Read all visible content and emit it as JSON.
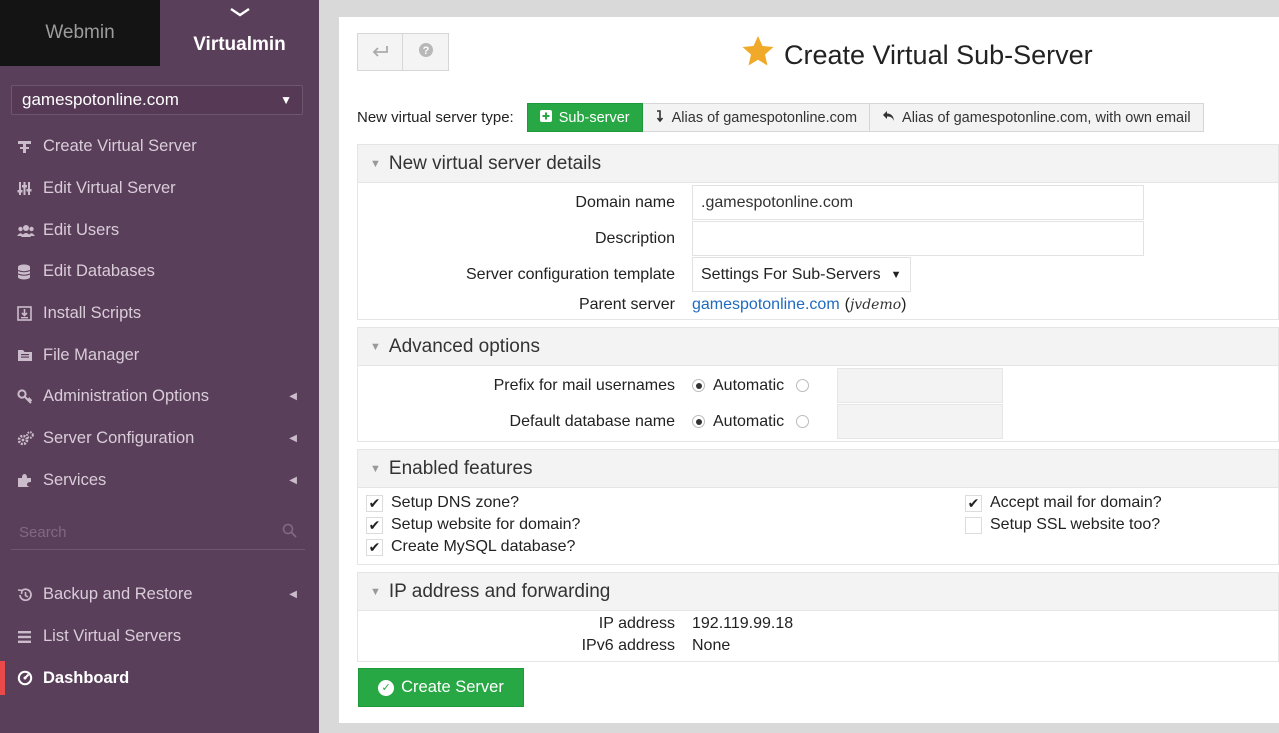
{
  "sidebar": {
    "tabs": {
      "webmin": "Webmin",
      "virtualmin": "Virtualmin"
    },
    "domain_selected": "gamespotonline.com",
    "menu": [
      {
        "label": "Create Virtual Server",
        "icon": "plus-icon"
      },
      {
        "label": "Edit Virtual Server",
        "icon": "sliders-icon"
      },
      {
        "label": "Edit Users",
        "icon": "users-icon"
      },
      {
        "label": "Edit Databases",
        "icon": "database-icon"
      },
      {
        "label": "Install Scripts",
        "icon": "download-icon"
      },
      {
        "label": "File Manager",
        "icon": "folder-icon"
      },
      {
        "label": "Administration Options",
        "icon": "key-icon"
      },
      {
        "label": "Server Configuration",
        "icon": "cogs-icon"
      },
      {
        "label": "Services",
        "icon": "puzzle-icon"
      }
    ],
    "search_placeholder": "Search",
    "menu_bottom": [
      {
        "label": "Backup and Restore",
        "icon": "history-icon"
      },
      {
        "label": "List Virtual Servers",
        "icon": "list-icon"
      },
      {
        "label": "Dashboard",
        "icon": "dashboard-icon"
      }
    ]
  },
  "main": {
    "title": "Create Virtual Sub-Server",
    "type_label": "New virtual server type:",
    "type_options": [
      "Sub-server",
      "Alias of gamespotonline.com",
      "Alias of gamespotonline.com, with own email"
    ],
    "sections": {
      "details": {
        "title": "New virtual server details",
        "domain_label": "Domain name",
        "domain_value": ".gamespotonline.com",
        "description_label": "Description",
        "description_value": "",
        "template_label": "Server configuration template",
        "template_value": "Settings For Sub-Servers",
        "parent_label": "Parent server",
        "parent_link": "gamespotonline.com",
        "parent_user": "jvdemo"
      },
      "advanced": {
        "title": "Advanced options",
        "prefix_label": "Prefix for mail usernames",
        "dbname_label": "Default database name",
        "automatic": "Automatic"
      },
      "features": {
        "title": "Enabled features",
        "left": [
          {
            "label": "Setup DNS zone?",
            "checked": true
          },
          {
            "label": "Setup website for domain?",
            "checked": true
          },
          {
            "label": "Create MySQL database?",
            "checked": true
          }
        ],
        "right": [
          {
            "label": "Accept mail for domain?",
            "checked": true
          },
          {
            "label": "Setup SSL website too?",
            "checked": false
          }
        ]
      },
      "ip": {
        "title": "IP address and forwarding",
        "ip_label": "IP address",
        "ip_value": "192.119.99.18",
        "ipv6_label": "IPv6 address",
        "ipv6_value": "None"
      }
    },
    "create_button": "Create Server"
  },
  "colors": {
    "sidebar_bg": "#5a3f5a",
    "accent_green": "#27a844",
    "active_marker": "#e84a4a",
    "star": "#f0a928",
    "link": "#1f6bbf"
  }
}
